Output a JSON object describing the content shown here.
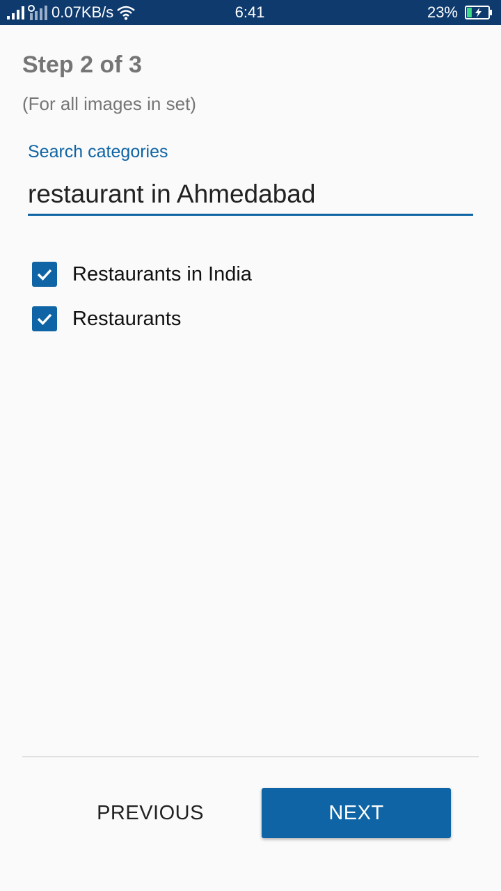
{
  "status_bar": {
    "network_speed": "0.07KB/s",
    "clock": "6:41",
    "battery_percent": "23%",
    "battery_level": 0.23,
    "icons": [
      "signal-icon",
      "signal-icon-sim2",
      "wifi-icon",
      "battery-charging-icon"
    ]
  },
  "wizard": {
    "step_title": "Step 2 of 3",
    "step_subtitle": "(For all images in set)"
  },
  "search": {
    "label": "Search categories",
    "value": "restaurant in Ahmedabad"
  },
  "categories": [
    {
      "label": "Restaurants in India",
      "checked": true
    },
    {
      "label": "Restaurants",
      "checked": true
    }
  ],
  "footer": {
    "previous_label": "PREVIOUS",
    "next_label": "NEXT"
  },
  "colors": {
    "status_bar": "#0e3a6e",
    "accent": "#0e64a4",
    "background": "#fafafa"
  }
}
